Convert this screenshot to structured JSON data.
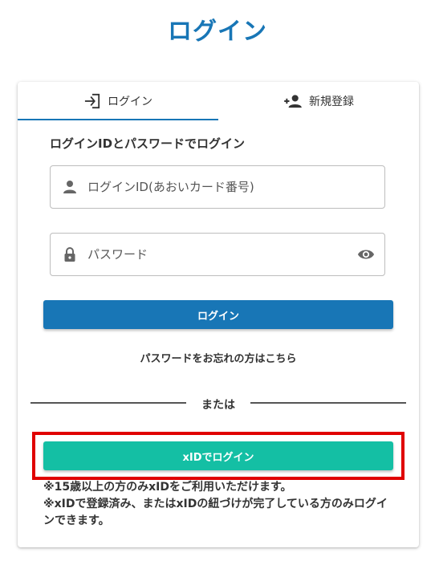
{
  "page": {
    "title": "ログイン"
  },
  "tabs": [
    {
      "label": "ログイン",
      "icon": "login-icon",
      "active": true
    },
    {
      "label": "新規登録",
      "icon": "person-add-icon",
      "active": false
    }
  ],
  "form": {
    "heading": "ログインIDとパスワードでログイン",
    "login_id": {
      "value": "",
      "placeholder": "ログインID(あおいカード番号)",
      "icon": "person-icon"
    },
    "password": {
      "value": "",
      "placeholder": "パスワード",
      "icon": "lock-icon",
      "toggle_icon": "eye-icon"
    },
    "submit_label": "ログイン",
    "forgot_link": "パスワードをお忘れの方はこちら"
  },
  "divider": {
    "text": "または"
  },
  "xid": {
    "button_label": "xIDでログイン",
    "notes": [
      "※15歳以上の方のみxIDをご利用いただけます。",
      "※xIDで登録済み、またはxIDの紐づけが完了している方のみログインできます。"
    ]
  },
  "colors": {
    "primary": "#1876b6",
    "xid_button": "#14bfa4",
    "highlight": "#e00000",
    "text": "#333333"
  }
}
